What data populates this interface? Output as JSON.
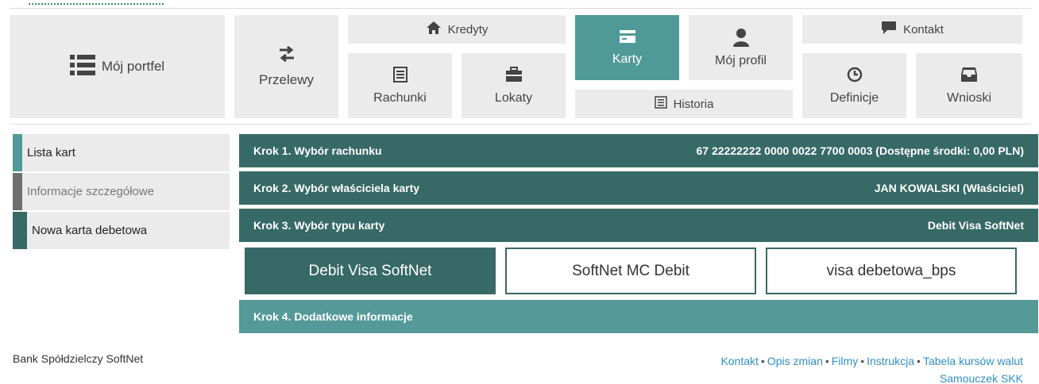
{
  "nav": {
    "portfel": "Mój portfel",
    "przelewy": "Przelewy",
    "kredyty": "Kredyty",
    "rachunki": "Rachunki",
    "lokaty": "Lokaty",
    "karty": "Karty",
    "profil": "Mój profil",
    "historia": "Historia",
    "kontakt": "Kontakt",
    "definicje": "Definicje",
    "wnioski": "Wnioski"
  },
  "sidebar": {
    "items": [
      {
        "label": "Lista kart",
        "color": "#4f9a98"
      },
      {
        "label": "Informacje szczegółowe",
        "color": "#6e6e6e"
      },
      {
        "label": "Nowa karta debetowa",
        "color": "#376966"
      }
    ]
  },
  "steps": [
    {
      "label": "Krok 1. Wybór rachunku",
      "value": "67 22222222 0000 0022 7700 0003 (Dostępne środki: 0,00 PLN)"
    },
    {
      "label": "Krok 2. Wybór właściciela karty",
      "value": "JAN KOWALSKI (Właściciel)"
    },
    {
      "label": "Krok 3. Wybór typu karty",
      "value": "Debit Visa SoftNet"
    },
    {
      "label": "Krok 4. Dodatkowe informacje",
      "value": ""
    }
  ],
  "card_options": [
    "Debit Visa SoftNet",
    "SoftNet MC Debit",
    "visa debetowa_bps"
  ],
  "footer": {
    "bank": "Bank Spółdzielczy SoftNet",
    "links": [
      "Kontakt",
      "Opis zmian",
      "Filmy",
      "Instrukcja",
      "Tabela kursów walut"
    ],
    "link2": "Samouczek SKK",
    "separator": "•"
  },
  "colors": {
    "dark_teal": "#376966",
    "teal": "#559998",
    "tile_bg": "#ebebeb",
    "link": "#2f8fc4"
  }
}
